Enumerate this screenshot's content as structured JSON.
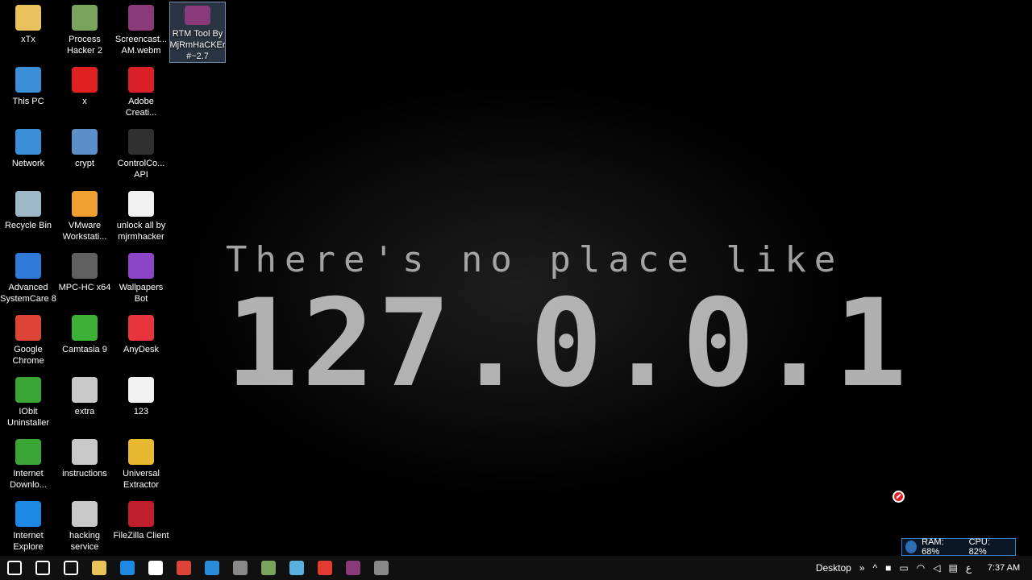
{
  "wallpaper": {
    "line1": "There's no place like",
    "line2": "127.0.0.1"
  },
  "icons": [
    {
      "label": "xTx",
      "icon": "folder-user-icon",
      "color": "#e8c25a"
    },
    {
      "label": "This PC",
      "icon": "computer-icon",
      "color": "#3b8fd6"
    },
    {
      "label": "Network",
      "icon": "network-icon",
      "color": "#3b8fd6"
    },
    {
      "label": "Recycle Bin",
      "icon": "recycle-bin-icon",
      "color": "#9fb8c8"
    },
    {
      "label": "Advanced SystemCare 8",
      "icon": "advanced-systemcare-icon",
      "color": "#2f7ad9"
    },
    {
      "label": "Google Chrome",
      "icon": "chrome-icon",
      "color": "#db4437"
    },
    {
      "label": "IObit Uninstaller",
      "icon": "iobit-icon",
      "color": "#3aa535"
    },
    {
      "label": "Internet Downlo...",
      "icon": "internet-download-manager-icon",
      "color": "#3aa535"
    },
    {
      "label": "Internet Explore",
      "icon": "internet-explorer-icon",
      "color": "#1e88e5"
    },
    {
      "label": "Process Hacker 2",
      "icon": "process-hacker-icon",
      "color": "#7aa35c"
    },
    {
      "label": "x",
      "icon": "stop-sign-icon",
      "color": "#e02020"
    },
    {
      "label": "crypt",
      "icon": "magnifier-icon",
      "color": "#5c8fc7"
    },
    {
      "label": "VMware Workstati...",
      "icon": "vmware-icon",
      "color": "#f0a030"
    },
    {
      "label": "MPC-HC x64",
      "icon": "mpc-hc-icon",
      "color": "#606060"
    },
    {
      "label": "Camtasia 9",
      "icon": "camtasia-icon",
      "color": "#3db036"
    },
    {
      "label": "extra",
      "icon": "generic-file-icon",
      "color": "#c8c8c8"
    },
    {
      "label": "instructions",
      "icon": "generic-file-icon",
      "color": "#c8c8c8"
    },
    {
      "label": "hacking service",
      "icon": "generic-file-icon",
      "color": "#c8c8c8"
    },
    {
      "label": "Screencast... AM.webm",
      "icon": "winrar-archive-icon",
      "color": "#8a3a7a"
    },
    {
      "label": "Adobe Creati...",
      "icon": "adobe-cc-icon",
      "color": "#da1f26"
    },
    {
      "label": "ControlCo... API",
      "icon": "playstation-icon",
      "color": "#303030"
    },
    {
      "label": "unlock all by mjrmhacker",
      "icon": "text-document-icon",
      "color": "#f0f0f0"
    },
    {
      "label": "Wallpapers Bot",
      "icon": "wallpapers-bot-icon",
      "color": "#8b45c5"
    },
    {
      "label": "AnyDesk",
      "icon": "anydesk-icon",
      "color": "#e8343d"
    },
    {
      "label": "123",
      "icon": "text-document-icon",
      "color": "#f0f0f0"
    },
    {
      "label": "Universal Extractor",
      "icon": "universal-extractor-icon",
      "color": "#e8b830"
    },
    {
      "label": "FileZilla Client",
      "icon": "filezilla-icon",
      "color": "#bf1e2d"
    },
    {
      "label": "RTM Tool By MjRmHaCKEr #~2.7",
      "icon": "winrar-archive-icon",
      "color": "#8a3a7a",
      "selected": true
    }
  ],
  "monitor": {
    "ram": "RAM: 68%",
    "cpu": "CPU: 82%"
  },
  "taskbar": {
    "apps": [
      "start-icon",
      "search-icon",
      "task-view-icon",
      "file-explorer-icon",
      "edge-icon",
      "store-icon",
      "chrome-icon",
      "ccleaner-icon",
      "cat-icon",
      "process-hacker-icon",
      "notepad-icon",
      "camtasia-recorder-icon",
      "winrar-icon",
      "cat-icon-2"
    ],
    "desktop_label": "Desktop",
    "input_lang": "ع",
    "clock": "7:37 AM"
  }
}
